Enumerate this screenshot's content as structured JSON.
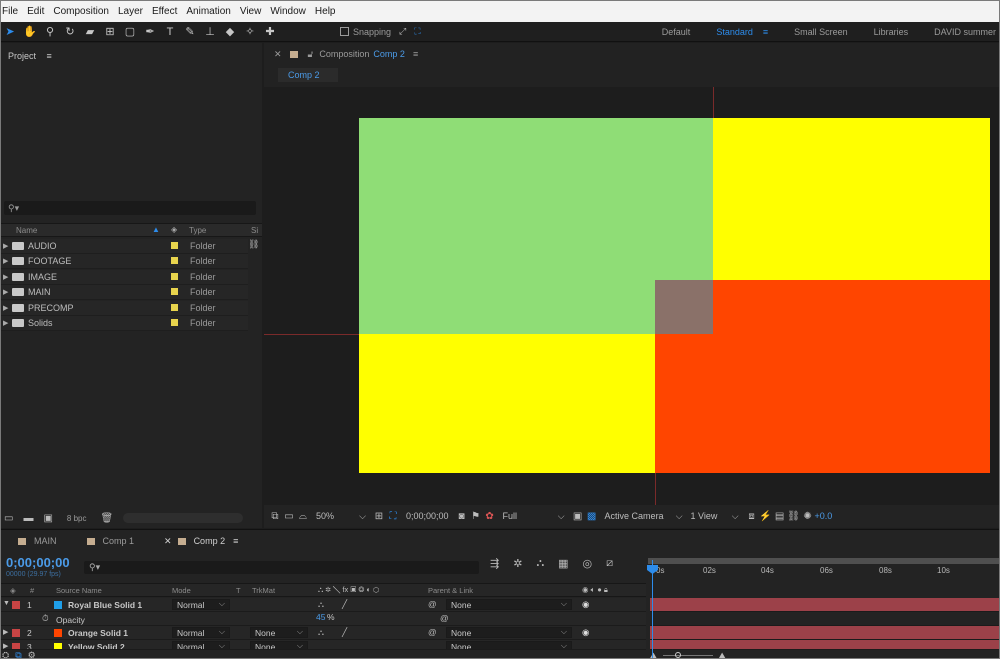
{
  "menu": [
    "File",
    "Edit",
    "Composition",
    "Layer",
    "Effect",
    "Animation",
    "View",
    "Window",
    "Help"
  ],
  "toolbar": {
    "snapping_label": "Snapping",
    "workspaces": [
      "Default",
      "Standard",
      "Small Screen",
      "Libraries",
      "DAVID summer"
    ],
    "active_workspace": "Standard"
  },
  "project": {
    "title": "Project",
    "search_icon": "⚲▾",
    "columns": {
      "name": "Name",
      "type": "Type",
      "size": "Si"
    },
    "items": [
      {
        "name": "AUDIO",
        "type": "Folder"
      },
      {
        "name": "FOOTAGE",
        "type": "Folder"
      },
      {
        "name": "IMAGE",
        "type": "Folder"
      },
      {
        "name": "MAIN",
        "type": "Folder"
      },
      {
        "name": "PRECOMP",
        "type": "Folder"
      },
      {
        "name": "Solids",
        "type": "Folder"
      }
    ],
    "bpc": "8 bpc"
  },
  "composition": {
    "tab_prefix": "Composition",
    "tab_name": "Comp 2",
    "subtab": "Comp 2",
    "zoom": "50%",
    "timecode": "0;00;00;00",
    "resolution": "Full",
    "camera": "Active Camera",
    "views": "1 View",
    "exposure": "+0.0",
    "colors": {
      "green": "#8fdd76",
      "yellow": "#ffff00",
      "orange": "#ff4500",
      "overlap": "#8a7169"
    }
  },
  "timeline": {
    "tabs": [
      "MAIN",
      "Comp 1",
      "Comp 2"
    ],
    "active_tab": "Comp 2",
    "timecode": "0;00;00;00",
    "fps": "00000 (29.97 fps)",
    "search_icon": "⚲▾",
    "headers": {
      "source_name": "Source Name",
      "mode": "Mode",
      "t": "T",
      "trkmat": "TrkMat",
      "parent": "Parent & Link",
      "num": "#"
    },
    "layers": [
      {
        "index": "1",
        "name": "Royal Blue Solid 1",
        "color": "#1f9ee8",
        "mode": "Normal",
        "trkmat": "",
        "parent": "None"
      },
      {
        "index": "2",
        "name": "Orange Solid 1",
        "color": "#ff4500",
        "mode": "Normal",
        "trkmat": "None",
        "parent": "None"
      },
      {
        "index": "3",
        "name": "Yellow Solid 2",
        "color": "#ffff00",
        "mode": "Normal",
        "trkmat": "None",
        "parent": "None"
      }
    ],
    "opacity_label": "Opacity",
    "opacity_value": "45",
    "opacity_unit": "%",
    "ruler_ticks": [
      "0s",
      "02s",
      "04s",
      "06s",
      "08s",
      "10s"
    ]
  }
}
